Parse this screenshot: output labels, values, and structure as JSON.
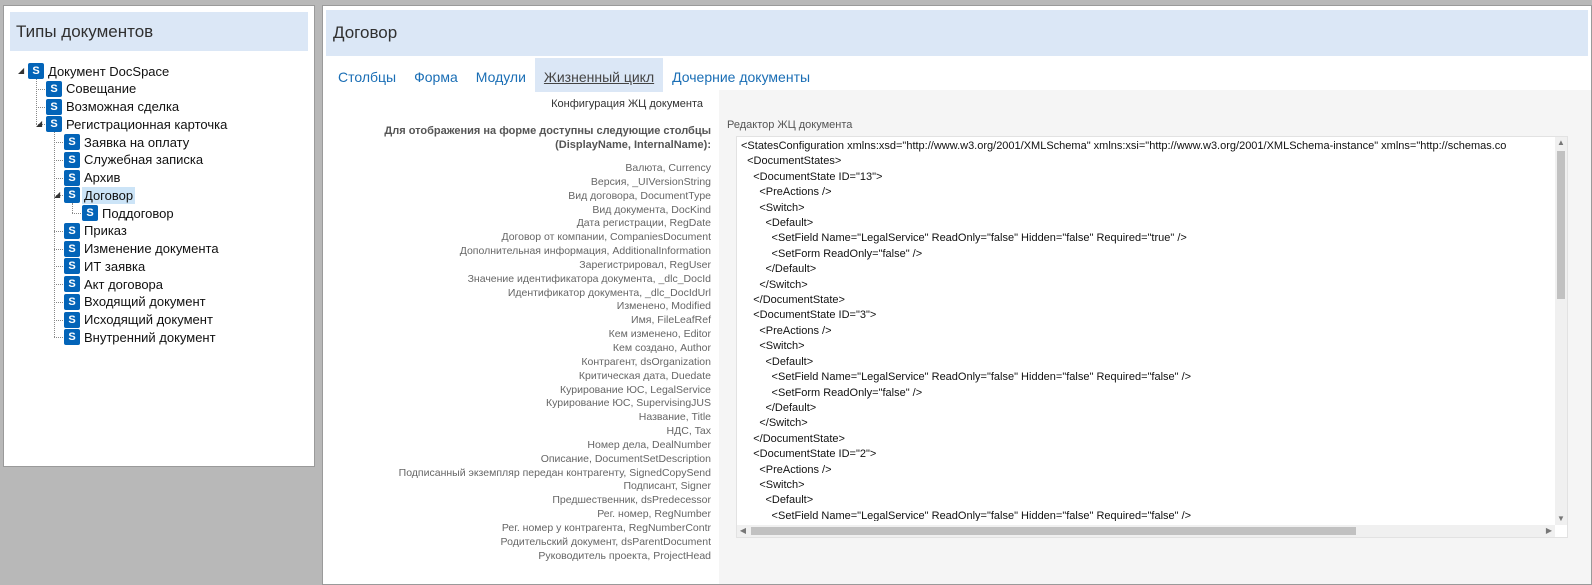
{
  "left_panel": {
    "title": "Типы документов",
    "tree": [
      {
        "label": "Документ DocSpace"
      },
      {
        "label": "Совещание"
      },
      {
        "label": "Возможная сделка"
      },
      {
        "label": "Регистрационная карточка"
      },
      {
        "label": "Заявка на оплату"
      },
      {
        "label": "Служебная записка"
      },
      {
        "label": "Архив"
      },
      {
        "label": "Договор",
        "selected": true
      },
      {
        "label": "Поддоговор"
      },
      {
        "label": "Приказ"
      },
      {
        "label": "Изменение документа"
      },
      {
        "label": "ИТ заявка"
      },
      {
        "label": "Акт договора"
      },
      {
        "label": "Входящий документ"
      },
      {
        "label": "Исходящий документ"
      },
      {
        "label": "Внутренний документ"
      }
    ],
    "node_icon": "sharepoint-icon"
  },
  "right_panel": {
    "title": "Договор",
    "tabs": [
      {
        "label": "Столбцы"
      },
      {
        "label": "Форма"
      },
      {
        "label": "Модули"
      },
      {
        "label": "Жизненный цикл",
        "active": true
      },
      {
        "label": "Дочерние документы"
      }
    ],
    "config_title": "Конфигурация ЖЦ документа",
    "columns_note": "Для отображения на форме доступны следующие столбцы (DisplayName, InternalName):",
    "columns": [
      "Валюта, Currency",
      "Версия, _UIVersionString",
      "Вид договора, DocumentType",
      "Вид документа, DocKind",
      "Дата регистрации, RegDate",
      "Договор от компании, CompaniesDocument",
      "Дополнительная информация, AdditionalInformation",
      "Зарегистрировал, RegUser",
      "Значение идентификатора документа, _dlc_DocId",
      "Идентификатор документа, _dlc_DocIdUrl",
      "Изменено, Modified",
      "Имя, FileLeafRef",
      "Кем изменено, Editor",
      "Кем создано, Author",
      "Контрагент, dsOrganization",
      "Критическая дата, Duedate",
      "Курирование ЮС, LegalService",
      "Курирование ЮС, SupervisingJUS",
      "Название, Title",
      "НДС, Tax",
      "Номер дела, DealNumber",
      "Описание, DocumentSetDescription",
      "Подписанный экземпляр передан контрагенту, SignedCopySend",
      "Подписант, Signer",
      "Предшественник, dsPredecessor",
      "Рег. номер, RegNumber",
      "Рег. номер у контрагента, RegNumberContr",
      "Родительский документ, dsParentDocument",
      "Руководитель проекта, ProjectHead"
    ],
    "editor_title": "Редактор ЖЦ документа",
    "editor_lines": [
      "<StatesConfiguration xmlns:xsd=\"http://www.w3.org/2001/XMLSchema\" xmlns:xsi=\"http://www.w3.org/2001/XMLSchema-instance\" xmlns=\"http://schemas.co",
      "  <DocumentStates>",
      "    <DocumentState ID=\"13\">",
      "      <PreActions />",
      "      <Switch>",
      "        <Default>",
      "          <SetField Name=\"LegalService\" ReadOnly=\"false\" Hidden=\"false\" Required=\"true\" />",
      "          <SetForm ReadOnly=\"false\" />",
      "        </Default>",
      "      </Switch>",
      "    </DocumentState>",
      "    <DocumentState ID=\"3\">",
      "      <PreActions />",
      "      <Switch>",
      "        <Default>",
      "          <SetField Name=\"LegalService\" ReadOnly=\"false\" Hidden=\"false\" Required=\"false\" />",
      "          <SetForm ReadOnly=\"false\" />",
      "        </Default>",
      "      </Switch>",
      "    </DocumentState>",
      "    <DocumentState ID=\"2\">",
      "      <PreActions />",
      "      <Switch>",
      "        <Default>",
      "          <SetField Name=\"LegalService\" ReadOnly=\"false\" Hidden=\"false\" Required=\"false\" />"
    ]
  }
}
